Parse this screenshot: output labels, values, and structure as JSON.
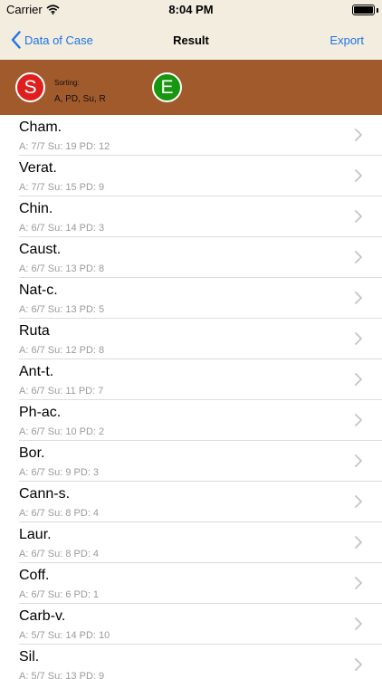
{
  "status": {
    "carrier": "Carrier",
    "time": "8:04 PM",
    "battery_level": 1.0
  },
  "nav": {
    "back_label": "Data of Case",
    "title": "Result",
    "export_label": "Export"
  },
  "sort_bar": {
    "s_label": "S",
    "e_label": "E",
    "sorting_label": "Sorting:",
    "sorting_value": "A, PD, Su, R"
  },
  "rows": [
    {
      "name": "Cham.",
      "meta": "A: 7/7   Su: 19      PD: 12"
    },
    {
      "name": "Verat.",
      "meta": "A: 7/7   Su: 15      PD: 9"
    },
    {
      "name": "Chin.",
      "meta": "A: 6/7   Su: 14      PD: 3"
    },
    {
      "name": "Caust.",
      "meta": "A: 6/7   Su: 13      PD: 8"
    },
    {
      "name": "Nat-c.",
      "meta": "A: 6/7   Su: 13      PD: 5"
    },
    {
      "name": "Ruta",
      "meta": "A: 6/7   Su: 12      PD: 8"
    },
    {
      "name": "Ant-t.",
      "meta": "A: 6/7   Su: 11      PD: 7"
    },
    {
      "name": "Ph-ac.",
      "meta": "A: 6/7   Su: 10      PD: 2"
    },
    {
      "name": "Bor.",
      "meta": "A: 6/7   Su: 9      PD: 3"
    },
    {
      "name": "Cann-s.",
      "meta": "A: 6/7   Su: 8      PD: 4"
    },
    {
      "name": "Laur.",
      "meta": "A: 6/7   Su: 8      PD: 4"
    },
    {
      "name": "Coff.",
      "meta": "A: 6/7   Su: 6      PD: 1"
    },
    {
      "name": "Carb-v.",
      "meta": "A: 5/7   Su: 14      PD: 10"
    },
    {
      "name": "Sil.",
      "meta": "A: 5/7   Su: 13      PD: 9"
    }
  ]
}
